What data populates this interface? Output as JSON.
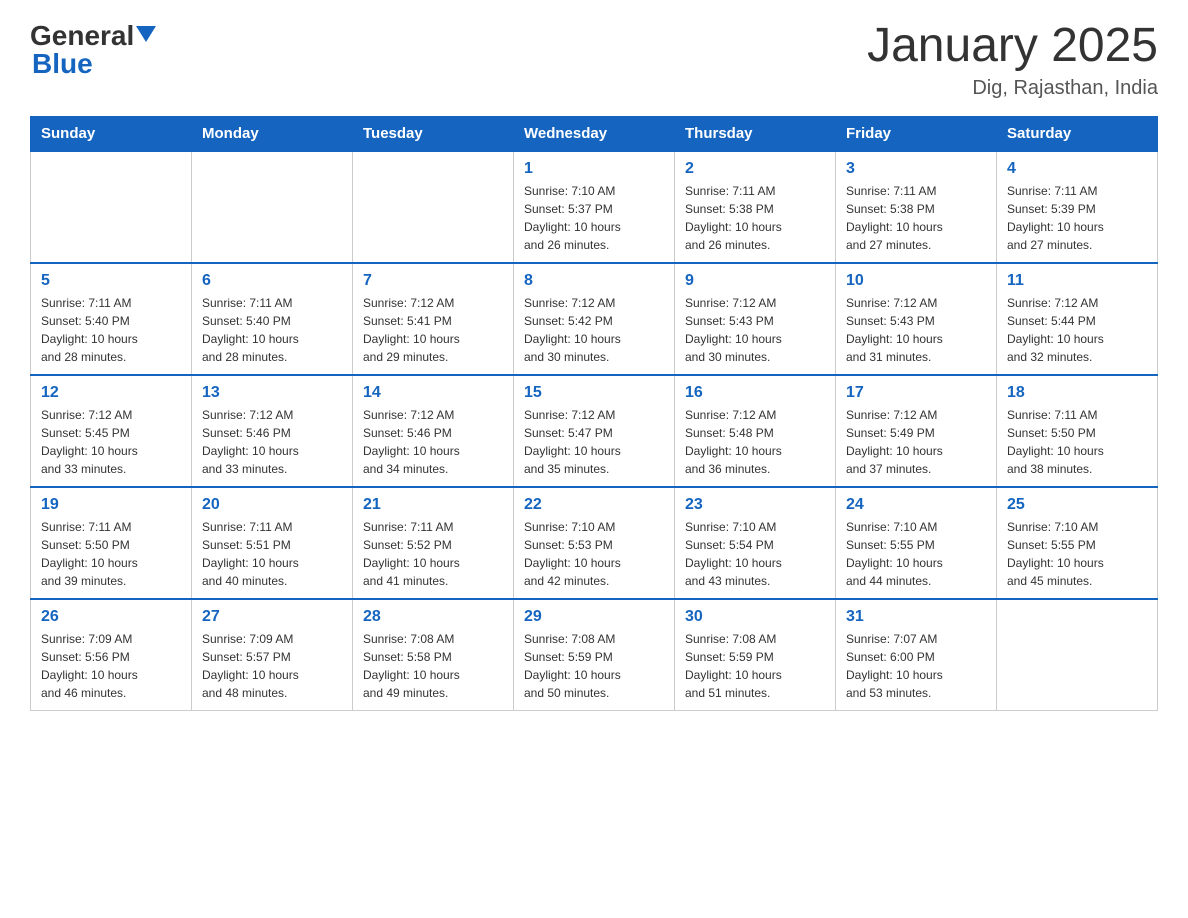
{
  "header": {
    "logo_general": "General",
    "logo_blue": "Blue",
    "month_title": "January 2025",
    "location": "Dig, Rajasthan, India"
  },
  "days_of_week": [
    "Sunday",
    "Monday",
    "Tuesday",
    "Wednesday",
    "Thursday",
    "Friday",
    "Saturday"
  ],
  "weeks": [
    [
      {
        "day": "",
        "info": ""
      },
      {
        "day": "",
        "info": ""
      },
      {
        "day": "",
        "info": ""
      },
      {
        "day": "1",
        "info": "Sunrise: 7:10 AM\nSunset: 5:37 PM\nDaylight: 10 hours\nand 26 minutes."
      },
      {
        "day": "2",
        "info": "Sunrise: 7:11 AM\nSunset: 5:38 PM\nDaylight: 10 hours\nand 26 minutes."
      },
      {
        "day": "3",
        "info": "Sunrise: 7:11 AM\nSunset: 5:38 PM\nDaylight: 10 hours\nand 27 minutes."
      },
      {
        "day": "4",
        "info": "Sunrise: 7:11 AM\nSunset: 5:39 PM\nDaylight: 10 hours\nand 27 minutes."
      }
    ],
    [
      {
        "day": "5",
        "info": "Sunrise: 7:11 AM\nSunset: 5:40 PM\nDaylight: 10 hours\nand 28 minutes."
      },
      {
        "day": "6",
        "info": "Sunrise: 7:11 AM\nSunset: 5:40 PM\nDaylight: 10 hours\nand 28 minutes."
      },
      {
        "day": "7",
        "info": "Sunrise: 7:12 AM\nSunset: 5:41 PM\nDaylight: 10 hours\nand 29 minutes."
      },
      {
        "day": "8",
        "info": "Sunrise: 7:12 AM\nSunset: 5:42 PM\nDaylight: 10 hours\nand 30 minutes."
      },
      {
        "day": "9",
        "info": "Sunrise: 7:12 AM\nSunset: 5:43 PM\nDaylight: 10 hours\nand 30 minutes."
      },
      {
        "day": "10",
        "info": "Sunrise: 7:12 AM\nSunset: 5:43 PM\nDaylight: 10 hours\nand 31 minutes."
      },
      {
        "day": "11",
        "info": "Sunrise: 7:12 AM\nSunset: 5:44 PM\nDaylight: 10 hours\nand 32 minutes."
      }
    ],
    [
      {
        "day": "12",
        "info": "Sunrise: 7:12 AM\nSunset: 5:45 PM\nDaylight: 10 hours\nand 33 minutes."
      },
      {
        "day": "13",
        "info": "Sunrise: 7:12 AM\nSunset: 5:46 PM\nDaylight: 10 hours\nand 33 minutes."
      },
      {
        "day": "14",
        "info": "Sunrise: 7:12 AM\nSunset: 5:46 PM\nDaylight: 10 hours\nand 34 minutes."
      },
      {
        "day": "15",
        "info": "Sunrise: 7:12 AM\nSunset: 5:47 PM\nDaylight: 10 hours\nand 35 minutes."
      },
      {
        "day": "16",
        "info": "Sunrise: 7:12 AM\nSunset: 5:48 PM\nDaylight: 10 hours\nand 36 minutes."
      },
      {
        "day": "17",
        "info": "Sunrise: 7:12 AM\nSunset: 5:49 PM\nDaylight: 10 hours\nand 37 minutes."
      },
      {
        "day": "18",
        "info": "Sunrise: 7:11 AM\nSunset: 5:50 PM\nDaylight: 10 hours\nand 38 minutes."
      }
    ],
    [
      {
        "day": "19",
        "info": "Sunrise: 7:11 AM\nSunset: 5:50 PM\nDaylight: 10 hours\nand 39 minutes."
      },
      {
        "day": "20",
        "info": "Sunrise: 7:11 AM\nSunset: 5:51 PM\nDaylight: 10 hours\nand 40 minutes."
      },
      {
        "day": "21",
        "info": "Sunrise: 7:11 AM\nSunset: 5:52 PM\nDaylight: 10 hours\nand 41 minutes."
      },
      {
        "day": "22",
        "info": "Sunrise: 7:10 AM\nSunset: 5:53 PM\nDaylight: 10 hours\nand 42 minutes."
      },
      {
        "day": "23",
        "info": "Sunrise: 7:10 AM\nSunset: 5:54 PM\nDaylight: 10 hours\nand 43 minutes."
      },
      {
        "day": "24",
        "info": "Sunrise: 7:10 AM\nSunset: 5:55 PM\nDaylight: 10 hours\nand 44 minutes."
      },
      {
        "day": "25",
        "info": "Sunrise: 7:10 AM\nSunset: 5:55 PM\nDaylight: 10 hours\nand 45 minutes."
      }
    ],
    [
      {
        "day": "26",
        "info": "Sunrise: 7:09 AM\nSunset: 5:56 PM\nDaylight: 10 hours\nand 46 minutes."
      },
      {
        "day": "27",
        "info": "Sunrise: 7:09 AM\nSunset: 5:57 PM\nDaylight: 10 hours\nand 48 minutes."
      },
      {
        "day": "28",
        "info": "Sunrise: 7:08 AM\nSunset: 5:58 PM\nDaylight: 10 hours\nand 49 minutes."
      },
      {
        "day": "29",
        "info": "Sunrise: 7:08 AM\nSunset: 5:59 PM\nDaylight: 10 hours\nand 50 minutes."
      },
      {
        "day": "30",
        "info": "Sunrise: 7:08 AM\nSunset: 5:59 PM\nDaylight: 10 hours\nand 51 minutes."
      },
      {
        "day": "31",
        "info": "Sunrise: 7:07 AM\nSunset: 6:00 PM\nDaylight: 10 hours\nand 53 minutes."
      },
      {
        "day": "",
        "info": ""
      }
    ]
  ]
}
